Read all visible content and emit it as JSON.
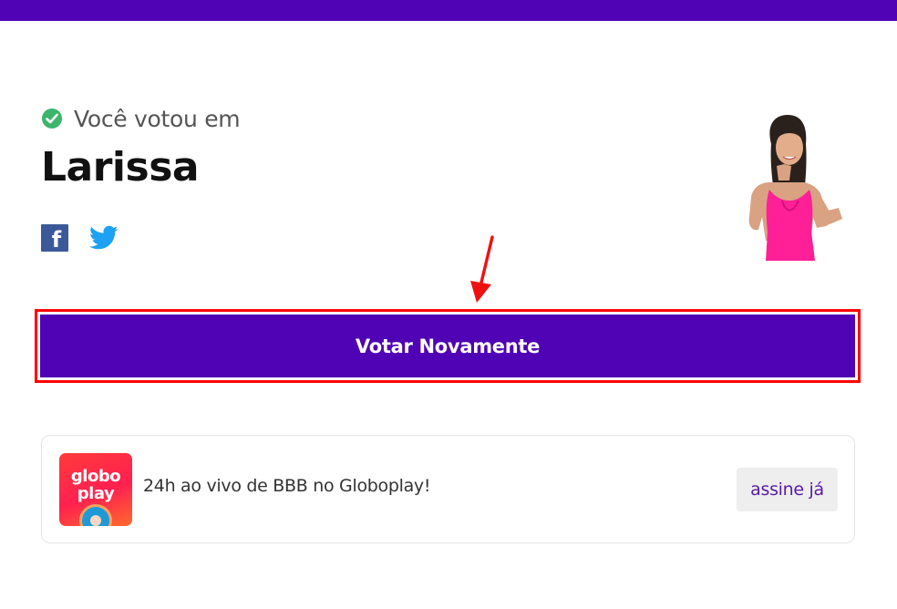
{
  "result": {
    "voted_label": "Você votou em",
    "candidate_name": "Larissa"
  },
  "share": {
    "facebook_icon": "facebook-icon",
    "twitter_icon": "twitter-icon"
  },
  "actions": {
    "vote_again_label": "Votar Novamente"
  },
  "promo": {
    "logo_line1": "globo",
    "logo_line2": "play",
    "text": "24h ao vivo de BBB no Globoplay!",
    "subscribe_label": "assine já"
  },
  "colors": {
    "brand_purple": "#5003b4",
    "highlight_red": "#ff0000",
    "success_green": "#3bb56b",
    "facebook_blue": "#3b5998",
    "twitter_blue": "#1da1f2"
  }
}
